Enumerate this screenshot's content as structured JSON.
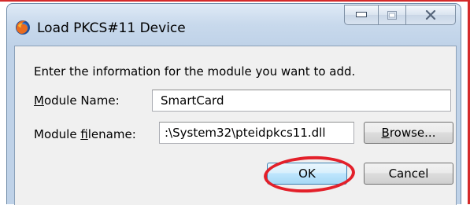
{
  "window": {
    "title": "Load PKCS#11 Device",
    "app_icon": "firefox-icon",
    "caption_buttons": [
      "minimize-icon",
      "maximize-icon",
      "close-icon"
    ]
  },
  "form": {
    "instruction": "Enter the information for the module you want to add.",
    "module_name_label_pre": "",
    "module_name_label_key": "M",
    "module_name_label_post": "odule Name:",
    "module_name_value": "SmartCard",
    "module_file_label_pre": "Module ",
    "module_file_label_key": "f",
    "module_file_label_post": "ilename:",
    "module_file_value": ":\\System32\\pteidpkcs11.dll",
    "browse_label_key": "B",
    "browse_label_post": "rowse...",
    "ok_label": "OK",
    "cancel_label": "Cancel"
  },
  "colors": {
    "annotation_red": "#e3202a",
    "titlebar": "#c8d9ec"
  }
}
